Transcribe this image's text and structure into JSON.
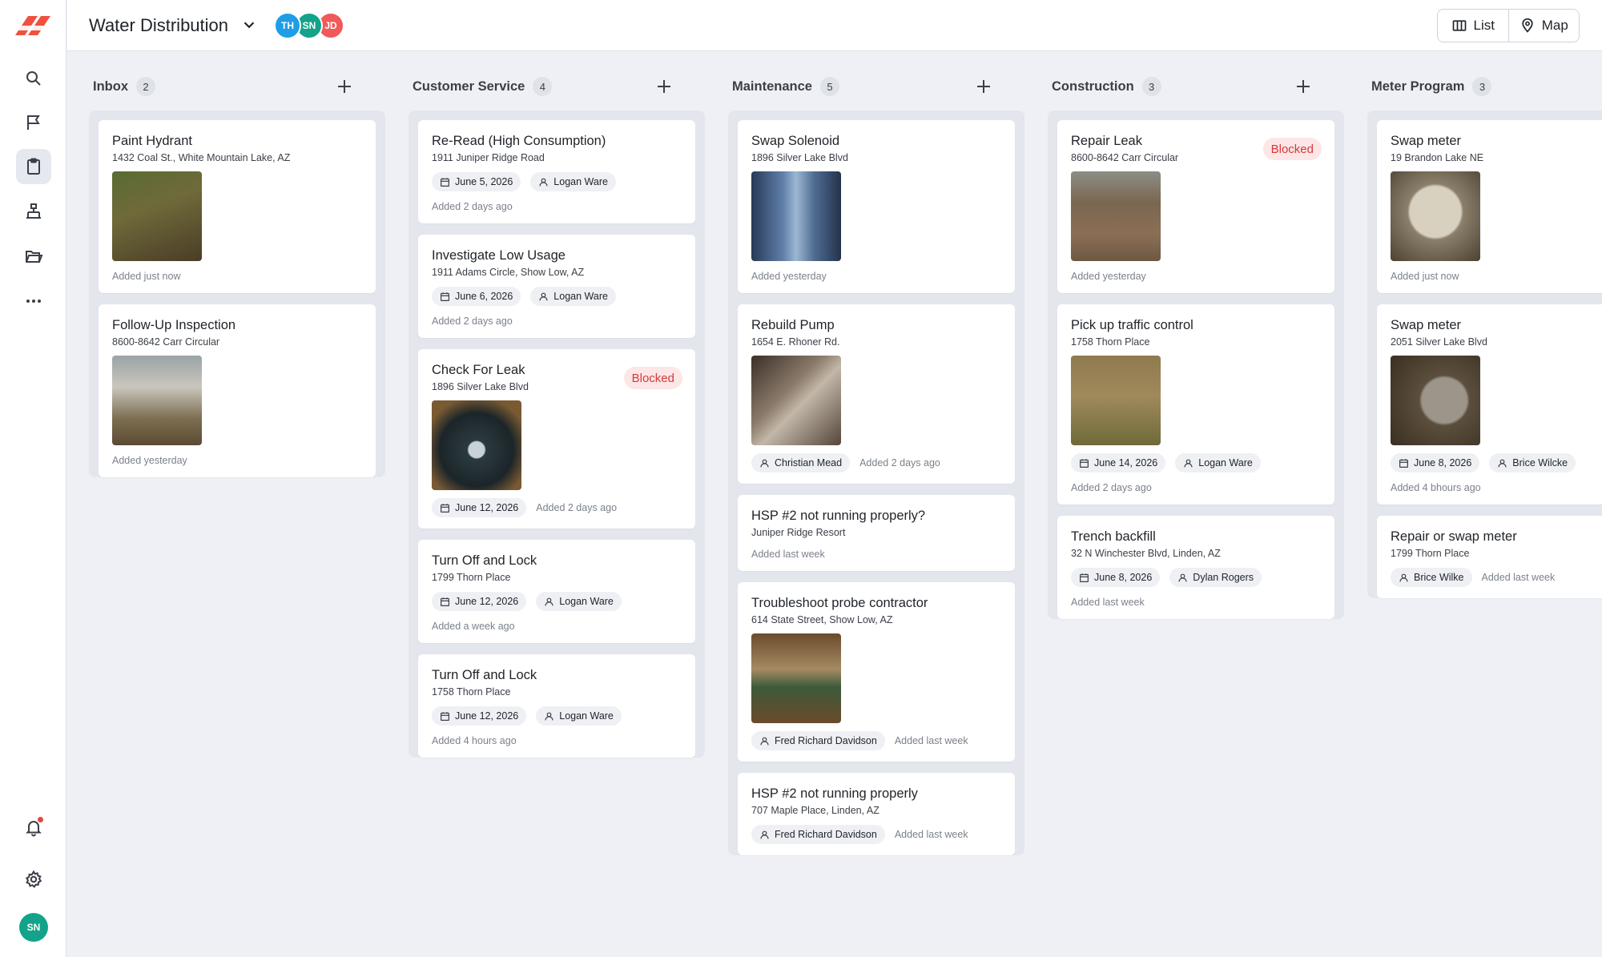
{
  "header": {
    "board_title": "Water Distribution",
    "members": [
      {
        "initials": "TH",
        "color": "#1e9ee6"
      },
      {
        "initials": "SN",
        "color": "#13a38a"
      },
      {
        "initials": "JD",
        "color": "#f05a5a"
      }
    ],
    "views": {
      "list_label": "List",
      "map_label": "Map"
    }
  },
  "sidebar": {
    "icons": [
      "search-icon",
      "flag-icon",
      "clipboard-icon",
      "hierarchy-icon",
      "folder-icon",
      "more-icon",
      "bell-icon",
      "gear-icon"
    ],
    "user_initials": "SN"
  },
  "columns": [
    {
      "title": "Inbox",
      "count": "2",
      "cards": [
        {
          "title": "Paint Hydrant",
          "address": "1432 Coal St., White Mountain Lake, AZ",
          "image": "hydrant",
          "added": "Added just now"
        },
        {
          "title": "Follow-Up Inspection",
          "address": "8600-8642 Carr Circular",
          "image": "truck",
          "added": "Added yesterday"
        }
      ]
    },
    {
      "title": "Customer Service",
      "count": "4",
      "cards": [
        {
          "title": "Re-Read (High Consumption)",
          "address": "1911 Juniper Ridge Road",
          "date": "June 5, 2026",
          "assignee": "Logan Ware",
          "added": "Added 2 days ago"
        },
        {
          "title": "Investigate Low Usage",
          "address": "1911 Adams Circle, Show Low, AZ",
          "date": "June 6, 2026",
          "assignee": "Logan Ware",
          "added": "Added 2 days ago"
        },
        {
          "title": "Check For Leak",
          "address": "1896 Silver Lake Blvd",
          "badge": "Blocked",
          "image": "box",
          "date": "June 12, 2026",
          "added": "Added 2 days ago"
        },
        {
          "title": "Turn Off and Lock",
          "address": "1799 Thorn Place",
          "date": "June 12, 2026",
          "assignee": "Logan Ware",
          "added": "Added a week ago"
        },
        {
          "title": "Turn Off and Lock",
          "address": "1758 Thorn Place",
          "date": "June 12, 2026",
          "assignee": "Logan Ware",
          "added": "Added 4 hours ago"
        }
      ]
    },
    {
      "title": "Maintenance",
      "count": "5",
      "cards": [
        {
          "title": "Swap Solenoid",
          "address": "1896 Silver Lake Blvd",
          "image": "solenoid",
          "added": "Added yesterday"
        },
        {
          "title": "Rebuild Pump",
          "address": "1654 E. Rhoner Rd.",
          "image": "pump",
          "assignee": "Christian Mead",
          "added": "Added 2 days ago"
        },
        {
          "title": "HSP #2 not running properly?",
          "address": "Juniper Ridge Resort",
          "added": "Added last week"
        },
        {
          "title": "Troubleshoot probe contractor",
          "address": "614 State Street, Show Low, AZ",
          "image": "panel",
          "assignee": "Fred Richard Davidson",
          "added": "Added last week"
        },
        {
          "title": "HSP #2 not running properly",
          "address": "707 Maple Place, Linden, AZ",
          "assignee": "Fred Richard Davidson",
          "added": "Added last week"
        }
      ]
    },
    {
      "title": "Construction",
      "count": "3",
      "cards": [
        {
          "title": "Repair Leak",
          "address": "8600-8642 Carr Circular",
          "badge": "Blocked",
          "image": "dirt",
          "added": "Added yesterday"
        },
        {
          "title": "Pick up traffic control",
          "address": "1758 Thorn Place",
          "image": "field",
          "date": "June 14, 2026",
          "assignee": "Logan Ware",
          "added": "Added 2 days ago"
        },
        {
          "title": "Trench backfill",
          "address": "32 N Winchester Blvd, Linden, AZ",
          "date": "June 8, 2026",
          "assignee": "Dylan Rogers",
          "added": "Added last week"
        }
      ]
    },
    {
      "title": "Meter Program",
      "count": "3",
      "cards": [
        {
          "title": "Swap meter",
          "address": "19 Brandon Lake NE",
          "image": "meter",
          "added": "Added just now"
        },
        {
          "title": "Swap meter",
          "address": "2051 Silver Lake Blvd",
          "image": "meter2",
          "date": "June 8, 2026",
          "assignee": "Brice Wilcke",
          "added": "Added 4 bhours ago"
        },
        {
          "title": "Repair or swap meter",
          "address": "1799 Thorn Place",
          "assignee": "Brice Wilke",
          "added": "Added last week"
        }
      ]
    }
  ]
}
